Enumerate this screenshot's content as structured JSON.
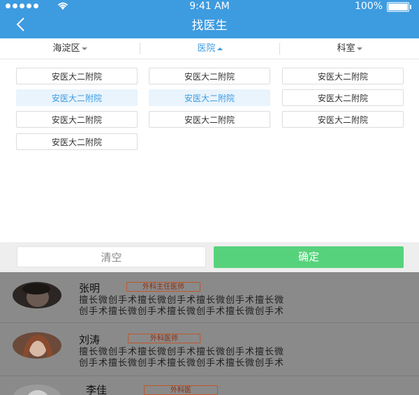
{
  "status_bar": {
    "time": "9:41 AM",
    "battery": "100%"
  },
  "header": {
    "title": "找医生"
  },
  "filters": [
    {
      "label": "海淀区",
      "active": false
    },
    {
      "label": "医院",
      "active": true
    },
    {
      "label": "科室",
      "active": false
    }
  ],
  "hospitals": [
    {
      "label": "安医大二附院",
      "selected": false
    },
    {
      "label": "安医大二附院",
      "selected": false
    },
    {
      "label": "安医大二附院",
      "selected": false
    },
    {
      "label": "安医大二附院",
      "selected": true
    },
    {
      "label": "安医大二附院",
      "selected": true
    },
    {
      "label": "安医大二附院",
      "selected": false
    },
    {
      "label": "安医大二附院",
      "selected": false
    },
    {
      "label": "安医大二附院",
      "selected": false
    },
    {
      "label": "安医大二附院",
      "selected": false
    },
    {
      "label": "安医大二附院",
      "selected": false
    }
  ],
  "actions": {
    "clear": "清空",
    "confirm": "确定"
  },
  "doctors": [
    {
      "name": "张明",
      "title": "外科主任医师",
      "desc_line1": "擅长微创手术擅长微创手术擅长微创手术擅长微",
      "desc_line2": "创手术擅长微创手术擅长微创手术擅长微创手术"
    },
    {
      "name": "刘涛",
      "title": "外科医师",
      "desc_line1": "擅长微创手术擅长微创手术擅长微创手术擅长微",
      "desc_line2": "创手术擅长微创手术擅长微创手术擅长微创手术"
    },
    {
      "name": "李佳",
      "title": "外科医"
    }
  ],
  "colors": {
    "primary": "#3d9be0",
    "confirm": "#57d27c",
    "badge": "#c0562a"
  }
}
